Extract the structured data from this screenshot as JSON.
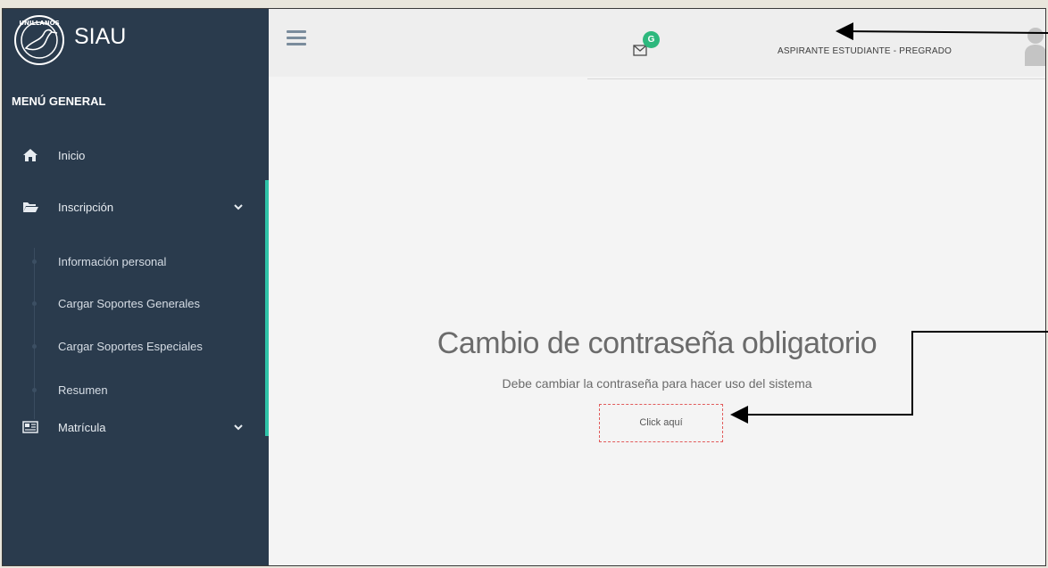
{
  "app": {
    "name": "SIAU",
    "logo_text": "UNILLANOS"
  },
  "sidebar": {
    "menu_title": "MENÚ GENERAL",
    "items": [
      {
        "label": "Inicio",
        "icon": "home-icon"
      },
      {
        "label": "Inscripción",
        "icon": "folder-open-icon",
        "expanded": true
      },
      {
        "label": "Matrícula",
        "icon": "newspaper-icon",
        "expanded": false
      }
    ],
    "subitems": [
      {
        "label": "Información personal"
      },
      {
        "label": "Cargar Soportes Generales"
      },
      {
        "label": "Cargar Soportes Especiales"
      },
      {
        "label": "Resumen"
      }
    ]
  },
  "topbar": {
    "notification_badge": "G",
    "user_role": "ASPIRANTE ESTUDIANTE - PREGRADO"
  },
  "main": {
    "heading": "Cambio de contraseña obligatorio",
    "message": "Debe cambiar la contraseña para hacer uso del sistema",
    "link_label": "Click aquí"
  },
  "colors": {
    "sidebar_bg": "#2a3b4d",
    "accent": "#2fc3a8",
    "badge": "#2db87d",
    "highlight_border": "#e15b5b"
  }
}
